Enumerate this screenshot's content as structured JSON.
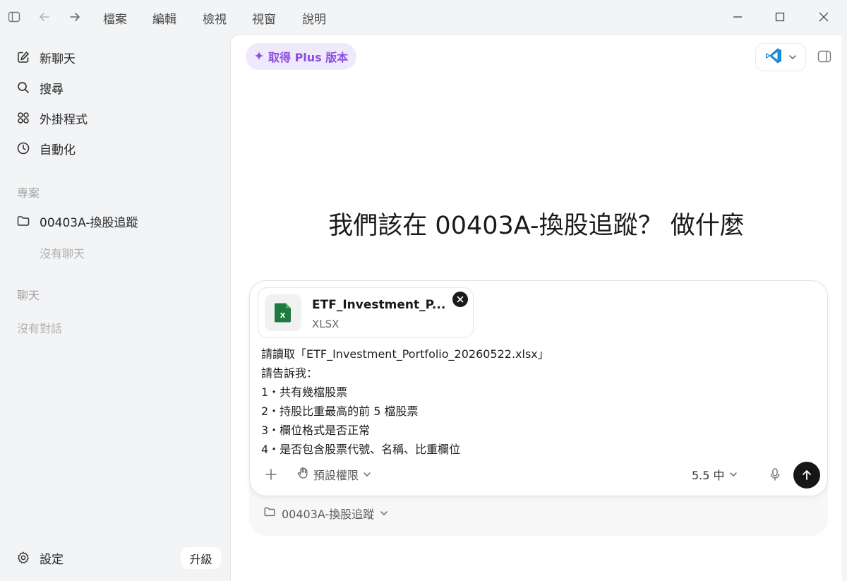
{
  "titlebar": {
    "menu": [
      "檔案",
      "編輯",
      "檢視",
      "視窗",
      "說明"
    ]
  },
  "sidebar": {
    "nav": [
      {
        "label": "新聊天",
        "icon": "edit-icon"
      },
      {
        "label": "搜尋",
        "icon": "search-icon"
      },
      {
        "label": "外掛程式",
        "icon": "plugins-icon"
      },
      {
        "label": "自動化",
        "icon": "clock-icon"
      }
    ],
    "projects_label": "專案",
    "project_name": "00403A-換股追蹤",
    "project_empty": "沒有聊天",
    "chats_label": "聊天",
    "chats_empty": "沒有對話",
    "settings_label": "設定",
    "upgrade_label": "升級"
  },
  "main": {
    "plus_label": "取得 Plus 版本",
    "hero": "我們該在 00403A-換股追蹤？ 做什麼",
    "attachment": {
      "name": "ETF_Investment_P...",
      "type": "XLSX",
      "icon_letter": "X"
    },
    "prompt_lines": [
      "請讀取「ETF_Investment_Portfolio_20260522.xlsx」",
      "請告訴我：",
      "1・共有幾檔股票",
      "2・持股比重最高的前 5 檔股票",
      "3・欄位格式是否正常",
      "4・是否包含股票代號、名稱、比重欄位"
    ],
    "permission_label": "預設權限",
    "model_label": "5.5 中",
    "project_chip": "00403A-換股追蹤"
  },
  "colors": {
    "accent_purple": "#8a4fe0",
    "plus_bg": "#f0e9fc",
    "send_bg": "#161616",
    "excel_green": "#1e7a3e",
    "vscode_blue": "#1f8ad2"
  }
}
